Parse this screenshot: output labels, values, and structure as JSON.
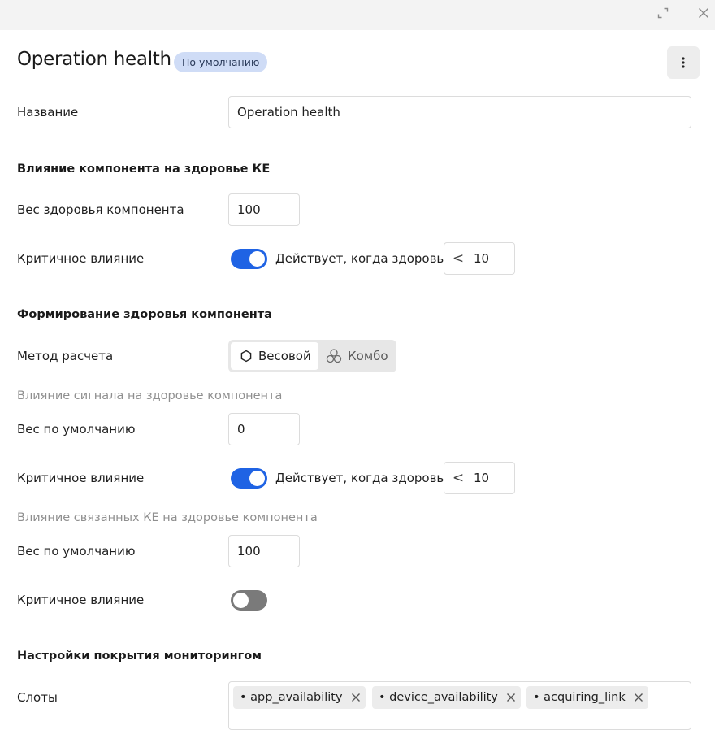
{
  "header": {
    "title": "Operation health",
    "badge": "По умолчанию"
  },
  "form": {
    "name_label": "Название",
    "name_value": "Operation health",
    "section_component": "Влияние компонента на здоровье КЕ",
    "weight_label": "Вес здоровья компонента",
    "weight_value": "100",
    "critical_label": "Критичное влияние",
    "critical_on": true,
    "critical_text": "Действует, когда здоровье",
    "critical_op": "<",
    "critical_value": "10",
    "section_forming": "Формирование здоровья компонента",
    "method_label": "Метод расчета",
    "method_options": [
      "Весовой",
      "Комбо"
    ],
    "method_selected": "Весовой",
    "signal_sub": "Влияние сигнала на здоровье компонента",
    "signal_weight_label": "Вес по умолчанию",
    "signal_weight_value": "0",
    "signal_critical_label": "Критичное влияние",
    "signal_critical_on": true,
    "signal_critical_text": "Действует, когда здоровье",
    "signal_critical_op": "<",
    "signal_critical_value": "10",
    "related_sub": "Влияние связанных КЕ на здоровье компонента",
    "related_weight_label": "Вес по умолчанию",
    "related_weight_value": "100",
    "related_critical_label": "Критичное влияние",
    "related_critical_on": false,
    "section_monitoring": "Настройки покрытия мониторингом",
    "slots_label": "Слоты",
    "slots": [
      "• app_availability",
      "• device_availability",
      "• acquiring_link"
    ]
  },
  "colors": {
    "accent": "#1f63e4",
    "badge_bg": "#cfdcf6",
    "toggle_off": "#7a7a7a"
  },
  "icons": [
    "expand-icon",
    "close-icon",
    "more-vertical-icon",
    "hexagon-icon",
    "combo-icon",
    "chip-remove-icon"
  ]
}
